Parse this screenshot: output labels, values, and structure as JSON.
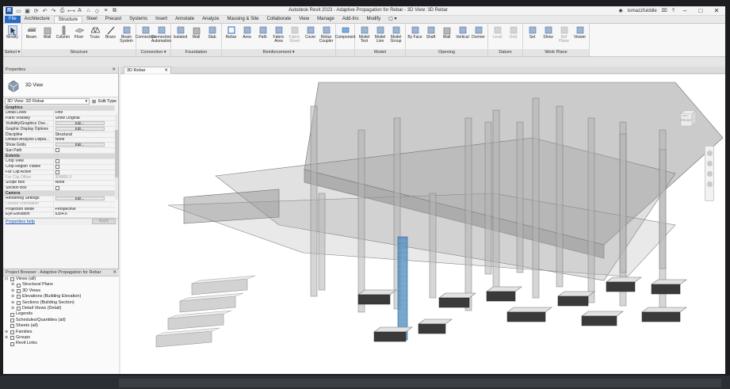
{
  "app": {
    "title": "Autodesk Revit 2023 - Adaptive Propagation for Rebar - 3D View: 3D Rebar",
    "user": "tomazzfuiddle",
    "help": "?"
  },
  "tabs": [
    "File",
    "Architecture",
    "Structure",
    "Steel",
    "Precast",
    "Systems",
    "Insert",
    "Annotate",
    "Analyze",
    "Massing & Site",
    "Collaborate",
    "View",
    "Manage",
    "Add-Ins",
    "Modify",
    "▢ ▾"
  ],
  "ribbon": {
    "panels": [
      {
        "label": "Select ▾",
        "tools": [
          "Modify"
        ]
      },
      {
        "label": "Structure",
        "tools": [
          "Beam",
          "Wall",
          "Column",
          "Floor",
          "Truss",
          "Brace",
          "Beam System"
        ]
      },
      {
        "label": "Connection ▾",
        "tools": [
          "Connection",
          "Connection Automation"
        ]
      },
      {
        "label": "Foundation",
        "tools": [
          "Isolated",
          "Wall",
          "Slab"
        ]
      },
      {
        "label": "Reinforcement ▾",
        "tools": [
          "Rebar",
          "Area",
          "Path",
          "Fabric Area",
          "Fabric Sheet",
          "Cover",
          "Rebar Coupler"
        ]
      },
      {
        "label": "",
        "tools": [
          "Component"
        ]
      },
      {
        "label": "Model",
        "tools": [
          "Model Text",
          "Model Line",
          "Model Group"
        ]
      },
      {
        "label": "Opening",
        "tools": [
          "By Face",
          "Shaft",
          "Wall",
          "Vertical",
          "Dormer"
        ]
      },
      {
        "label": "Datum",
        "tools": [
          "Level",
          "Grid"
        ]
      },
      {
        "label": "Work Plane",
        "tools": [
          "Set",
          "Show",
          "Ref Plane",
          "Viewer"
        ]
      }
    ]
  },
  "properties": {
    "title": "Properties",
    "type_name": "3D View",
    "type_selector": "3D View: 3D Rebar",
    "edit_type": "Edit Type",
    "rows": [
      {
        "kind": "hdr",
        "label": "Graphics"
      },
      {
        "label": "Detail Level",
        "value": "Fine"
      },
      {
        "label": "Parts Visibility",
        "value": "Show Original"
      },
      {
        "label": "Visibility/Graphics Ove...",
        "value": "Edit...",
        "button": true
      },
      {
        "label": "Graphic Display Options",
        "value": "Edit...",
        "button": true
      },
      {
        "label": "Discipline",
        "value": "Structural"
      },
      {
        "label": "Default Analysis Displa...",
        "value": "None"
      },
      {
        "label": "Show Grids",
        "value": "Edit...",
        "button": true
      },
      {
        "label": "Sun Path",
        "value": "",
        "check": true
      },
      {
        "kind": "hdr",
        "label": "Extents"
      },
      {
        "label": "Crop View",
        "value": "",
        "check": true
      },
      {
        "label": "Crop Region Visible",
        "value": "",
        "check": true
      },
      {
        "label": "Far Clip Active",
        "value": "",
        "check": true
      },
      {
        "label": "Far Clip Offset",
        "value": "304800.0",
        "dim": true
      },
      {
        "label": "Scope Box",
        "value": "None"
      },
      {
        "label": "Section Box",
        "value": "",
        "check": true
      },
      {
        "kind": "hdr",
        "label": "Camera"
      },
      {
        "label": "Rendering Settings",
        "value": "Edit...",
        "button": true
      },
      {
        "label": "Locked Orientation",
        "value": "",
        "dim": true
      },
      {
        "label": "Projection Mode",
        "value": "Perspective"
      },
      {
        "label": "Eye Elevation",
        "value": "5354.6"
      }
    ],
    "help_link": "Properties help",
    "apply": "Apply"
  },
  "browser": {
    "title": "Project Browser - Adaptive Propagation for Rebar",
    "items": [
      {
        "depth": 0,
        "toggle": "⊟",
        "label": "Views (all)"
      },
      {
        "depth": 1,
        "toggle": "⊕",
        "label": "Structural Plans"
      },
      {
        "depth": 1,
        "toggle": "⊕",
        "label": "3D Views"
      },
      {
        "depth": 1,
        "toggle": "⊕",
        "label": "Elevations (Building Elevation)"
      },
      {
        "depth": 1,
        "toggle": "⊕",
        "label": "Sections (Building Section)"
      },
      {
        "depth": 1,
        "toggle": "⊕",
        "label": "Detail Views (Detail)"
      },
      {
        "depth": 0,
        "toggle": "",
        "label": "Legends"
      },
      {
        "depth": 0,
        "toggle": "",
        "label": "Schedules/Quantities (all)"
      },
      {
        "depth": 0,
        "toggle": "",
        "label": "Sheets (all)"
      },
      {
        "depth": 0,
        "toggle": "⊕",
        "label": "Families"
      },
      {
        "depth": 0,
        "toggle": "⊕",
        "label": "Groups"
      },
      {
        "depth": 0,
        "toggle": "",
        "label": "Revit Links"
      }
    ]
  },
  "view": {
    "tab": "3D Rebar",
    "cube_face": "FRONT",
    "cube_side": "RIGHT"
  },
  "colors": {
    "file_tab": "#2a6ac7",
    "rebar_column": "#4a86c8",
    "concrete": "#bfbfbf"
  }
}
